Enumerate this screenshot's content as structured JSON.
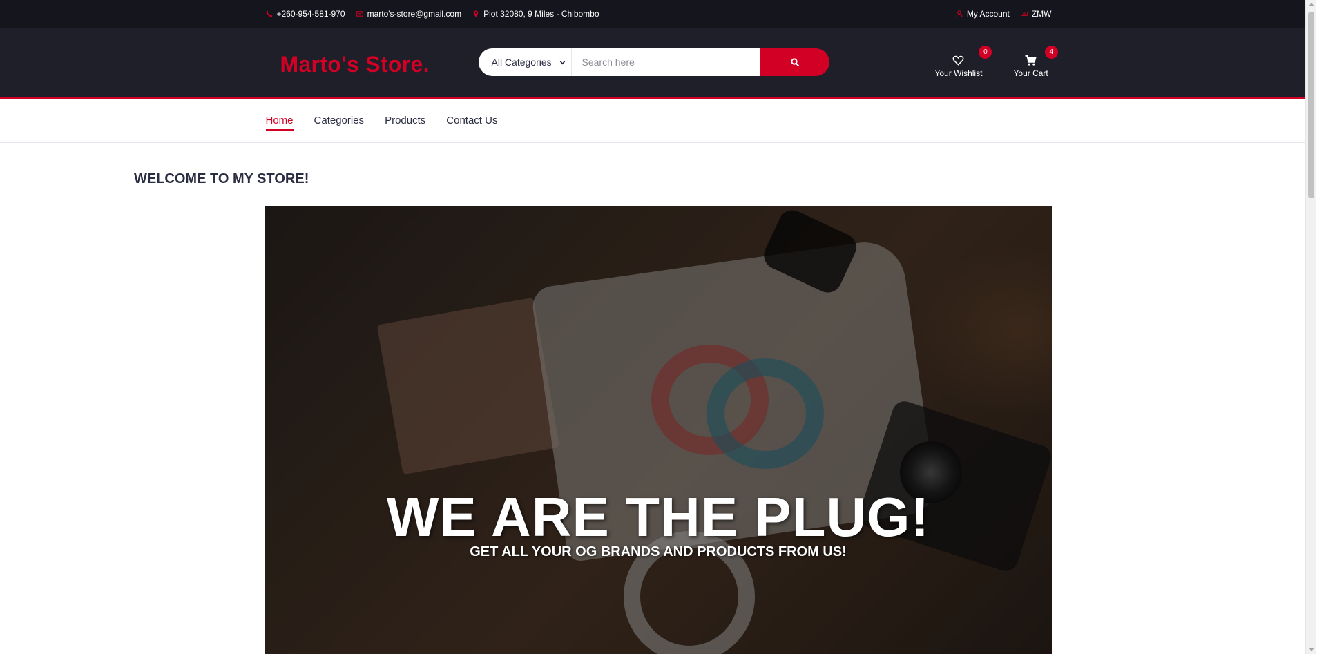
{
  "colors": {
    "accent": "#d10024",
    "topbar_bg": "#15161d",
    "header_bg": "#1e1f29",
    "text_dark": "#2b2d42"
  },
  "topbar": {
    "phone": "+260-954-581-970",
    "email": "marto's-store@gmail.com",
    "address": "Plot 32080, 9 Miles - Chibombo",
    "account": "My Account",
    "currency": "ZMW",
    "icons": {
      "phone": "phone-icon",
      "email": "envelope-icon",
      "address": "map-marker-icon",
      "account": "user-icon",
      "currency": "money-icon"
    }
  },
  "header": {
    "logo": "Marto's Store.",
    "category_select": "All Categories",
    "search_placeholder": "Search here",
    "wishlist": {
      "label": "Your Wishlist",
      "count": "0"
    },
    "cart": {
      "label": "Your Cart",
      "count": "4"
    }
  },
  "nav": {
    "items": [
      {
        "label": "Home",
        "active": true
      },
      {
        "label": "Categories"
      },
      {
        "label": "Products"
      },
      {
        "label": "Contact Us"
      }
    ]
  },
  "main": {
    "welcome": "WELCOME TO MY STORE!",
    "hero": {
      "title": "WE ARE THE PLUG!",
      "subtitle": "GET ALL YOUR OG BRANDS AND PRODUCTS FROM US!"
    }
  }
}
